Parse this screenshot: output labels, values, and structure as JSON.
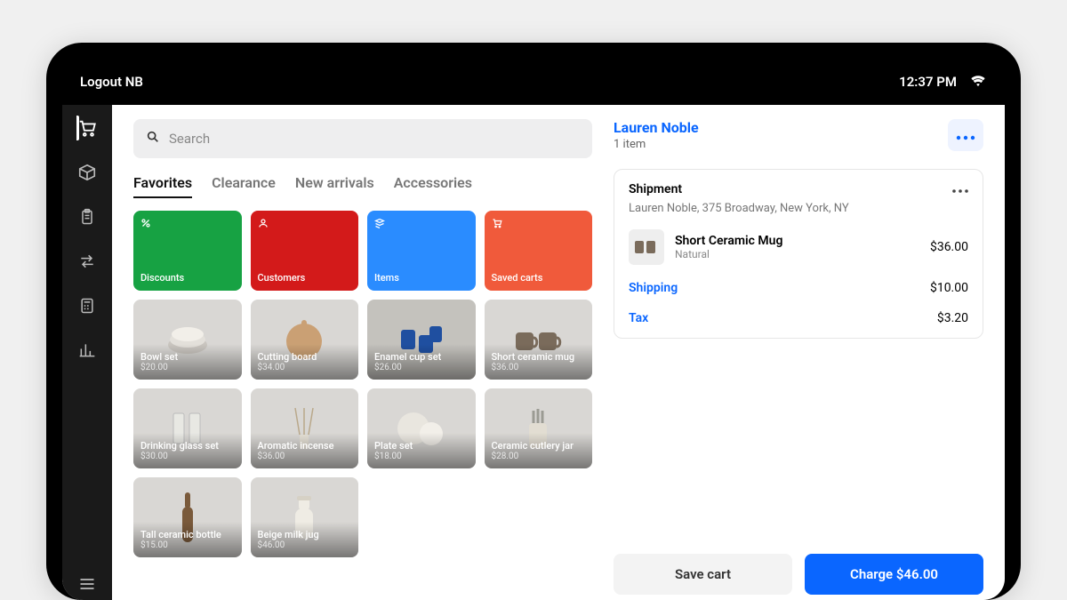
{
  "statusbar": {
    "left": "Logout NB",
    "time": "12:37 PM"
  },
  "sidebar": {
    "items": [
      {
        "name": "cart",
        "active": true
      },
      {
        "name": "package",
        "active": false
      },
      {
        "name": "clipboard",
        "active": false
      },
      {
        "name": "transfer",
        "active": false
      },
      {
        "name": "calculator",
        "active": false
      },
      {
        "name": "analytics",
        "active": false
      }
    ]
  },
  "search": {
    "placeholder": "Search"
  },
  "tabs": [
    {
      "label": "Favorites",
      "active": true
    },
    {
      "label": "Clearance",
      "active": false
    },
    {
      "label": "New arrivals",
      "active": false
    },
    {
      "label": "Accessories",
      "active": false
    }
  ],
  "quick_tiles": [
    {
      "label": "Discounts",
      "color": "#17a243",
      "icon": "percent"
    },
    {
      "label": "Customers",
      "color": "#d31a1a",
      "icon": "person"
    },
    {
      "label": "Items",
      "color": "#2a8cff",
      "icon": "stack"
    },
    {
      "label": "Saved carts",
      "color": "#f05a3b",
      "icon": "cart"
    }
  ],
  "products": [
    {
      "name": "Bowl set",
      "price": "$20.00"
    },
    {
      "name": "Cutting board",
      "price": "$34.00"
    },
    {
      "name": "Enamel cup set",
      "price": "$26.00"
    },
    {
      "name": "Short ceramic mug",
      "price": "$36.00"
    },
    {
      "name": "Drinking glass set",
      "price": "$30.00"
    },
    {
      "name": "Aromatic incense",
      "price": "$36.00"
    },
    {
      "name": "Plate set",
      "price": "$18.00"
    },
    {
      "name": "Ceramic cutlery jar",
      "price": "$28.00"
    },
    {
      "name": "Tall ceramic bottle",
      "price": "$15.00"
    },
    {
      "name": "Beige milk jug",
      "price": "$46.00"
    }
  ],
  "cart": {
    "customer": "Lauren Noble",
    "count_label": "1 item",
    "shipment": {
      "title": "Shipment",
      "address": "Lauren Noble, 375 Broadway, New York, NY",
      "item": {
        "name": "Short Ceramic Mug",
        "variant": "Natural",
        "price": "$36.00"
      },
      "shipping": {
        "label": "Shipping",
        "value": "$10.00"
      },
      "tax": {
        "label": "Tax",
        "value": "$3.20"
      }
    },
    "save_label": "Save cart",
    "charge_label": "Charge $46.00"
  }
}
